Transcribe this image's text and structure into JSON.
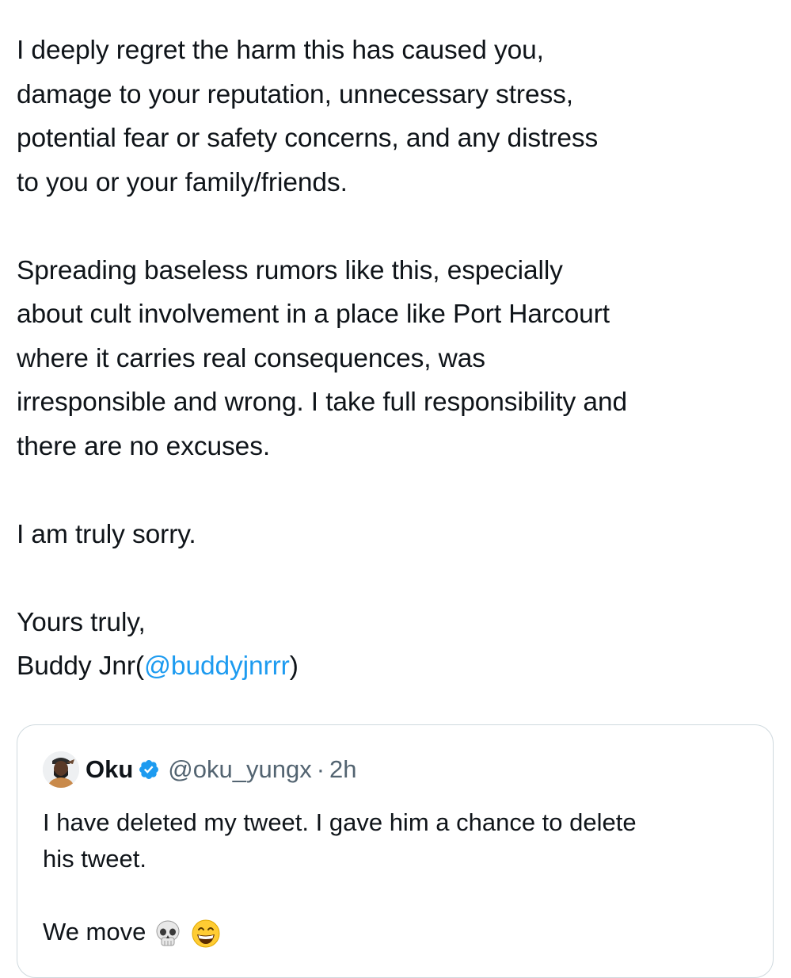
{
  "tweet": {
    "paragraphs": [
      {
        "lines": [
          "I deeply regret the harm this has caused you,",
          "damage to your reputation, unnecessary stress,",
          "potential fear or safety concerns, and any distress",
          "to you or your family/friends."
        ]
      },
      {
        "lines": [
          "Spreading baseless rumors like this, especially",
          "about cult involvement in a place like Port Harcourt",
          "where it carries real consequences, was",
          "irresponsible and wrong. I take full responsibility and",
          "there are no excuses."
        ]
      },
      {
        "lines": [
          "I am truly sorry."
        ]
      }
    ],
    "signoff": "Yours truly,",
    "signature_name": "Buddy Jnr(",
    "signature_mention": "@buddyjnrrr",
    "signature_close": ")"
  },
  "quote": {
    "name": "Oku",
    "handle": "@oku_yungx",
    "separator": "·",
    "time": "2h",
    "verified_icon": "verified-badge-icon",
    "text_lines": [
      "I have deleted my tweet. I gave him a chance to delete",
      "his tweet."
    ],
    "last_line": "We move",
    "emojis": [
      "skull-emoji-icon",
      "grinning-face-emoji-icon"
    ]
  },
  "colors": {
    "text": "#0f1419",
    "link": "#1d9bf0",
    "secondary": "#536471",
    "border": "#cfd9de",
    "verified": "#1d9bf0"
  }
}
